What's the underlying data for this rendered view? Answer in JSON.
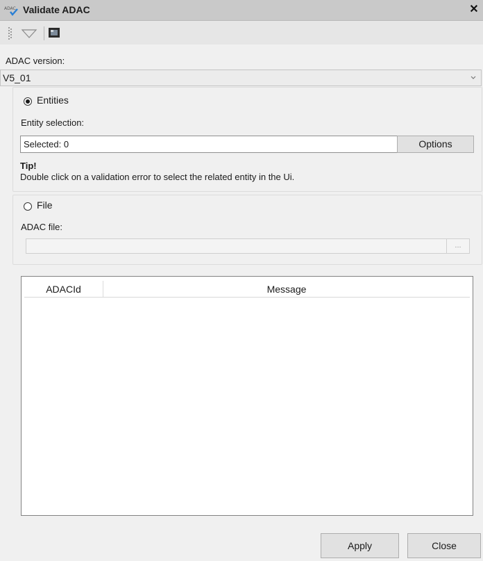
{
  "window": {
    "title": "Validate ADAC",
    "close_glyph": "✕",
    "icon": "adac-validate-icon"
  },
  "toolbar": {
    "icons": [
      "grip-handle",
      "triangle-down-icon",
      "monitor-icon"
    ]
  },
  "adac_version": {
    "label": "ADAC version:",
    "selected": "V5_01"
  },
  "entities": {
    "radio_label": "Entities",
    "selected": true,
    "selection_label": "Entity selection:",
    "selection_value": "Selected: 0",
    "options_button": "Options",
    "tip_title": "Tip!",
    "tip_text": "Double click on a validation error to select the related entity in the Ui."
  },
  "file": {
    "radio_label": "File",
    "selected": false,
    "file_label": "ADAC file:",
    "file_value": "",
    "browse_button": "..."
  },
  "results_table": {
    "columns": [
      "ADACId",
      "Message"
    ],
    "rows": []
  },
  "footer": {
    "apply_button": "Apply",
    "close_button": "Close"
  },
  "colors": {
    "titlebar": "#c9c9c9",
    "toolbar": "#e6e6e6",
    "panel": "#f0f0f0",
    "accent_icon": "#2a7fd4"
  }
}
